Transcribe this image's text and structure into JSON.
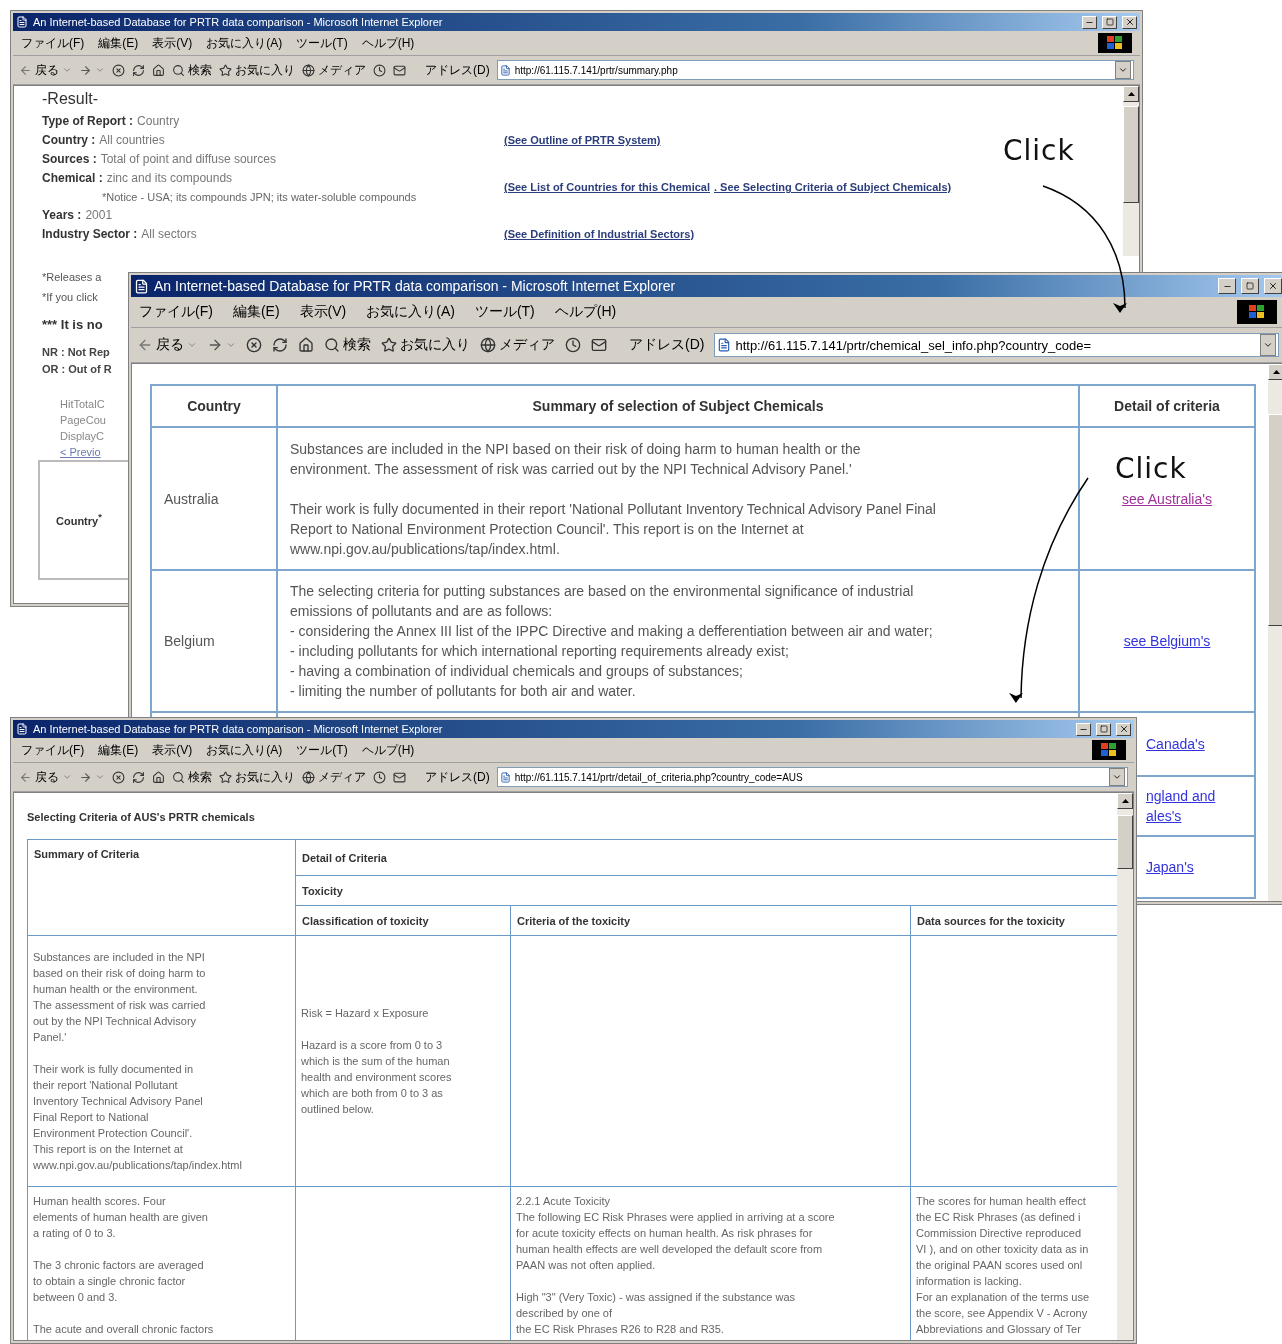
{
  "windows": [
    {
      "title": "An Internet-based Database for PRTR data comparison - Microsoft Internet Explorer",
      "menu": [
        "ファイル(F)",
        "編集(E)",
        "表示(V)",
        "お気に入り(A)",
        "ツール(T)",
        "ヘルプ(H)"
      ],
      "toolbar": {
        "back": "戻る",
        "search": "検索",
        "favorites": "お気に入り",
        "media": "メディア",
        "address_label": "アドレス(D)",
        "url": "http://61.115.7.141/prtr/summary.php"
      },
      "content": {
        "kind": "summary",
        "heading": "-Result-",
        "fields": [
          {
            "label": "Type of Report :",
            "value": "Country"
          },
          {
            "label": "Country :",
            "value": "All countries",
            "links": [
              "(See Outline of PRTR System)"
            ]
          },
          {
            "label": "Sources :",
            "value": "Total of point and diffuse sources"
          },
          {
            "label": "Chemical :",
            "value": "zinc and its compounds",
            "note": "*Notice - USA; its compounds JPN; its water-soluble compounds",
            "links": [
              "(See List of Countries for this Chemical",
              ". See Selecting Criteria of Subject Chemicals)"
            ]
          },
          {
            "label": "Years :",
            "value": "2001"
          },
          {
            "label": "Industry Sector :",
            "value": "All sectors",
            "links": [
              "(See Definition of Industrial Sectors)"
            ]
          }
        ],
        "notes": [
          "*Releases a",
          "*If you click"
        ],
        "warning": "*** It is no",
        "legend": [
          "NR : Not Rep",
          "OR : Out of R"
        ],
        "counters": [
          "HitTotalC",
          "PageCou",
          "DisplayC"
        ],
        "pager": "< Previo",
        "table_header": "Country$^{*}$"
      }
    },
    {
      "title": "An Internet-based Database for PRTR data comparison - Microsoft Internet Explorer",
      "menu": [
        "ファイル(F)",
        "編集(E)",
        "表示(V)",
        "お気に入り(A)",
        "ツール(T)",
        "ヘルプ(H)"
      ],
      "toolbar": {
        "back": "戻る",
        "search": "検索",
        "favorites": "お気に入り",
        "media": "メディア",
        "address_label": "アドレス(D)",
        "url": "http://61.115.7.141/prtr/chemical_sel_info.php?country_code="
      },
      "content": {
        "kind": "selection",
        "columns": [
          "Country",
          "Summary of selection of Subject Chemicals",
          "Detail of criteria"
        ],
        "rows": [
          {
            "kind": "full",
            "country": "Australia",
            "summary": "Substances are included in the NPI based on their risk of doing harm to human health or the\nenvironment. The assessment of risk was carried out by the NPI Technical Advisory Panel.'\n\nTheir work is fully documented in their report 'National Pollutant Inventory Technical Advisory Panel Final\nReport to National Environment Protection Council'. This report is on the Internet at\nwww.npi.gov.au/publications/tap/index.html.",
            "link": {
              "text": "see Australia's",
              "visited": true
            }
          },
          {
            "kind": "full",
            "country": "Belgium",
            "summary": "The selecting criteria for putting substances are based on the environmental significance of industrial\nemissions of pollutants and are as follows:\n- considering the Annex III list of the IPPC Directive and making a defferentiation between air and water;\n- including pollutants for which international reporting requirements already exist;\n- having a combination of individual chemicals and groups of substances;\n- limiting the number of pollutants for both air and water.",
            "link": {
              "text": "see Belgium's",
              "visited": false
            }
          },
          {
            "kind": "clipped",
            "link": {
              "text": "Canada's",
              "visited": false
            }
          },
          {
            "kind": "clipped",
            "link": {
              "text": "ngland and\nales's",
              "visited": false
            }
          },
          {
            "kind": "clipped",
            "link": {
              "text": "Japan's",
              "visited": false
            }
          }
        ]
      }
    },
    {
      "title": "An Internet-based Database for PRTR data comparison - Microsoft Internet Explorer",
      "menu": [
        "ファイル(F)",
        "編集(E)",
        "表示(V)",
        "お気に入り(A)",
        "ツール(T)",
        "ヘルプ(H)"
      ],
      "toolbar": {
        "back": "戻る",
        "search": "検索",
        "favorites": "お気に入り",
        "media": "メディア",
        "address_label": "アドレス(D)",
        "url": "http://61.115.7.141/prtr/detail_of_criteria.php?country_code=AUS"
      },
      "content": {
        "kind": "criteria",
        "heading": "Selecting Criteria of AUS's PRTR chemicals",
        "summary_header": "Summary of Criteria",
        "detail_header": "Detail of Criteria",
        "group_header": "Toxicity",
        "columns": [
          "Classification of toxicity",
          "Criteria of the toxicity",
          "Data sources for the toxicity"
        ],
        "rows": [
          {
            "summary": "Substances are included in the NPI\nbased on their risk of doing harm to\nhuman health or the environment.\nThe assessment of risk was carried\nout by the NPI Technical Advisory\nPanel.'\n\nTheir work is fully documented in\ntheir report 'National Pollutant\nInventory Technical Advisory Panel\nFinal Report to National\nEnvironment Protection Council'.\nThis report is on the Internet at\nwww.npi.gov.au/publications/tap/index.html",
            "classification": "Risk = Hazard x Exposure\n\nHazard is a score from 0 to 3\nwhich is the sum of the human\nhealth and environment scores\nwhich are both from 0 to 3 as\noutlined below."
          },
          {
            "summary": "Human health scores. Four\nelements of human health are given\na rating of 0 to 3.\n\nThe 3 chronic factors are averaged\nto obtain a single chronic factor\nbetween 0 and 3.\n\nThe acute and overall chronic factors",
            "criteria": "2.2.1 Acute Toxicity\nThe following EC Risk Phrases were applied in arriving at a score\nfor acute toxicity effects on human health. As risk phrases for\nhuman health effects are well developed the default score from\nPAAN was not often applied.\n\nHigh \"3\" (Very Toxic) - was assigned if the substance was\ndescribed by one of\nthe EC Risk Phrases R26 to R28 and R35.",
            "sources": "The scores for human health effect\nthe EC Risk Phrases (as defined i\nCommission Directive reproduced\nVI ), and on other toxicity data as in\nthe original PAAN scores used onl\ninformation is lacking.\nFor an explanation of the terms use\nthe score, see Appendix V - Acrony\nAbbreviations and Glossary of Ter"
          }
        ]
      }
    }
  ],
  "annotations": [
    {
      "label": "Click"
    },
    {
      "label": "Click"
    }
  ]
}
